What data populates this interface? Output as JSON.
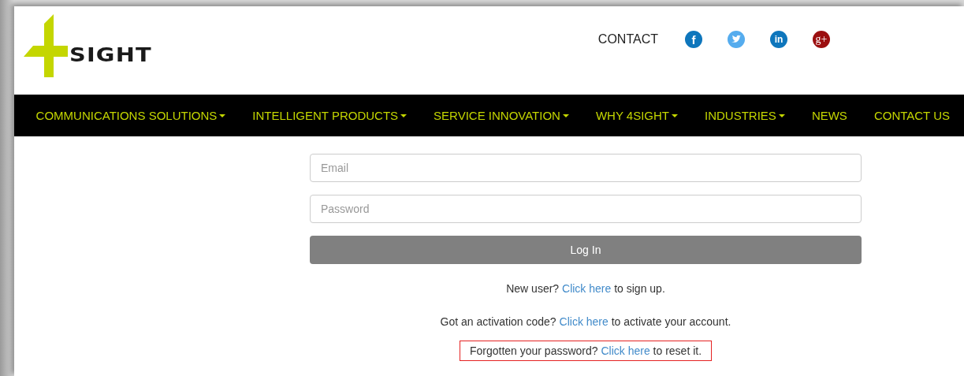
{
  "header": {
    "logo_text": "SIGHT",
    "contact": "CONTACT",
    "social": [
      {
        "kind": "facebook",
        "glyph": "f",
        "color": "#0e76bc"
      },
      {
        "kind": "twitter",
        "color": "#55acee"
      },
      {
        "kind": "linkedin",
        "glyph": "in",
        "color": "#0e76bc"
      },
      {
        "kind": "googleplus",
        "glyph": "g+",
        "color": "#9b0f10"
      }
    ]
  },
  "nav": [
    {
      "label": "COMMUNICATIONS SOLUTIONS",
      "dropdown": true
    },
    {
      "label": "INTELLIGENT PRODUCTS",
      "dropdown": true
    },
    {
      "label": "SERVICE INNOVATION",
      "dropdown": true
    },
    {
      "label": "WHY 4SIGHT",
      "dropdown": true
    },
    {
      "label": "INDUSTRIES",
      "dropdown": true
    },
    {
      "label": "NEWS",
      "dropdown": false
    },
    {
      "label": "CONTACT US",
      "dropdown": false
    }
  ],
  "form": {
    "email": {
      "placeholder": "Email"
    },
    "password": {
      "placeholder": "Password"
    },
    "submit": "Log In",
    "links": [
      {
        "before": "New user?",
        "link": "Click here",
        "after": "to sign up.",
        "highlighted": false
      },
      {
        "before": "Got an activation code?",
        "link": "Click here",
        "after": "to activate your account.",
        "highlighted": false
      },
      {
        "before": "Forgotten your password?",
        "link": "Click here",
        "after": "to reset it.",
        "highlighted": true
      }
    ]
  }
}
